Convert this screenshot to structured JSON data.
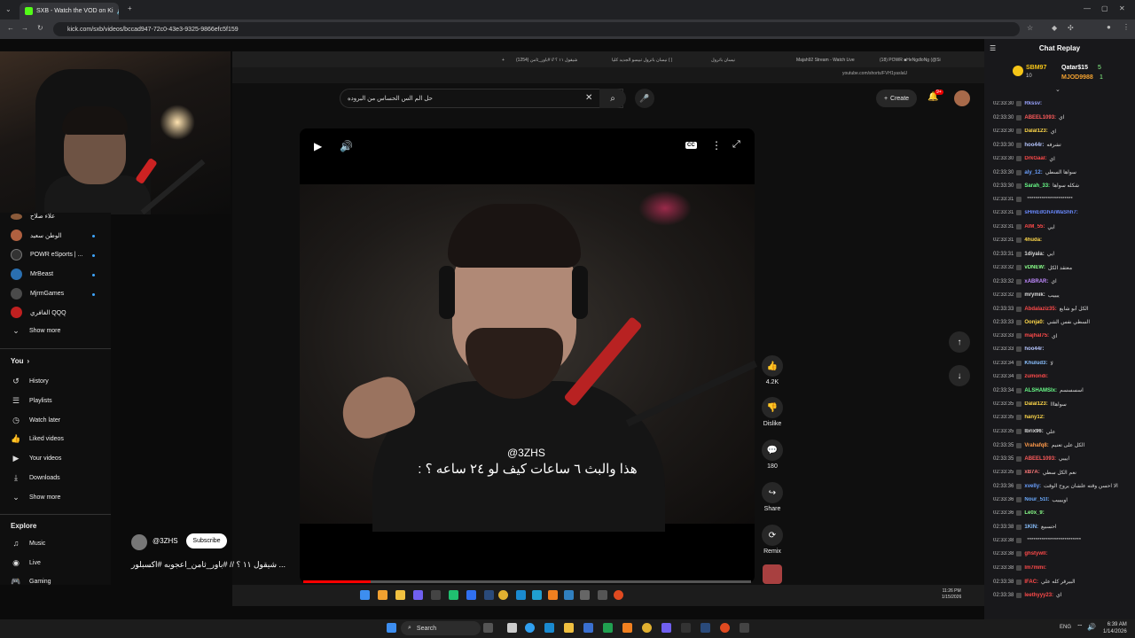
{
  "browser": {
    "active_tab_title": "SXB - Watch the VOD on Ki",
    "url": "kick.com/sxb/videos/bccad947-72c0-43e3-9325-9866efc5f159"
  },
  "inner_browser": {
    "tabs": [
      "شيقول ١١ ؟ // #باور_ثامن (1254)",
      "نيسان باترول تبيسو الجديد كليا ( |",
      "نيسان باترول",
      "Majah92 Stream - Watch Live",
      "(18) POWR ■HeNgdloNg (@Si"
    ],
    "url": "youtube.com/shorts/FVH1yaslaU"
  },
  "youtube": {
    "search_value": "حل الم الس الحساس من البروده",
    "create_label": "Create",
    "notif_count": "9+",
    "sidebar": {
      "subscriptions": [
        {
          "name": "علاء صلاح",
          "color": "#8a5a3a"
        },
        {
          "name": "الوطن سعيد",
          "color": "#b06040"
        },
        {
          "name": "POWR eSports | ...",
          "color": "#333333"
        },
        {
          "name": "MrBeast",
          "color": "#2a6fb0"
        },
        {
          "name": "MjrmGames",
          "color": "#4a4a4a"
        },
        {
          "name": "الغافري QQQ",
          "color": "#c02020"
        }
      ],
      "show_more_1": "Show more",
      "you_heading": "You",
      "you_items": [
        {
          "icon": "history-icon",
          "glyph": "↺",
          "label": "History"
        },
        {
          "icon": "playlists-icon",
          "glyph": "☰",
          "label": "Playlists"
        },
        {
          "icon": "watch-later-icon",
          "glyph": "◷",
          "label": "Watch later"
        },
        {
          "icon": "liked-videos-icon",
          "glyph": "👍",
          "label": "Liked videos"
        },
        {
          "icon": "your-videos-icon",
          "glyph": "▶",
          "label": "Your videos"
        },
        {
          "icon": "downloads-icon",
          "glyph": "⤓",
          "label": "Downloads"
        }
      ],
      "show_more_2": "Show more",
      "explore_heading": "Explore",
      "explore_items": [
        {
          "icon": "music-icon",
          "glyph": "♫",
          "label": "Music"
        },
        {
          "icon": "live-icon",
          "glyph": "◉",
          "label": "Live"
        },
        {
          "icon": "gaming-icon",
          "glyph": "🎮",
          "label": "Gaming"
        }
      ]
    },
    "short": {
      "handle": "@3ZHS",
      "caption": "هذا والبث ٦ ساعات كيف لو ٢٤ ساعه ؟ :",
      "channel": "@3ZHS",
      "subscribe_label": "Subscribe",
      "title": "... شيقول ١١ ؟ // #باور_ثامن_اعجوبه #اكسبلور",
      "progress": 0.15
    },
    "actions": [
      {
        "name": "like",
        "glyph": "👍",
        "label": "4.2K"
      },
      {
        "name": "dislike",
        "glyph": "👎",
        "label": "Dislike"
      },
      {
        "name": "comments",
        "glyph": "💬",
        "label": "180"
      },
      {
        "name": "share",
        "glyph": "↪",
        "label": "Share"
      },
      {
        "name": "remix",
        "glyph": "⟳",
        "label": "Remix"
      }
    ],
    "inner_clock": {
      "time": "11:26 PM",
      "date": "1/15/2026"
    }
  },
  "chat": {
    "title": "Chat Replay",
    "leaderboard": [
      {
        "rank_user": "SBM97",
        "count": "10"
      },
      {
        "rank_user": "Qatar$15",
        "count": "5"
      },
      {
        "rank_user": "MJOD9988",
        "count": "1"
      }
    ],
    "messages": [
      {
        "time": "02:33:30",
        "user": "Rkssv:",
        "color": "#9aa4ff",
        "text": ""
      },
      {
        "time": "02:33:30",
        "user": "ABEEL1093:",
        "color": "#ff5b5b",
        "text": "اي"
      },
      {
        "time": "02:33:30",
        "user": "Dalal123:",
        "color": "#ffd84a",
        "text": "اي"
      },
      {
        "time": "02:33:30",
        "user": "hoo44r:",
        "color": "#b6c6ff",
        "text": "تشرفه"
      },
      {
        "time": "02:33:30",
        "user": "DrkGaal:",
        "color": "#ff4a4a",
        "text": "اي"
      },
      {
        "time": "02:33:30",
        "user": "aly_12:",
        "color": "#6aa0ff",
        "text": "سواها السطي"
      },
      {
        "time": "02:33:30",
        "user": "Sarah_33:",
        "color": "#6aff8a",
        "text": "شكله سواها"
      },
      {
        "time": "02:33:31",
        "user": "",
        "color": "#ddd",
        "text": "**********************"
      },
      {
        "time": "02:33:31",
        "user": "sHmEdGhAiWaShh7:",
        "color": "#6a8aff",
        "text": ""
      },
      {
        "time": "02:33:31",
        "user": "AIM_55:",
        "color": "#ff4a4a",
        "text": "ايي"
      },
      {
        "time": "02:33:31",
        "user": "4huda:",
        "color": "#ffd84a",
        "text": ""
      },
      {
        "time": "02:33:31",
        "user": "1diyala:",
        "color": "#ddd",
        "text": "ايي"
      },
      {
        "time": "02:33:32",
        "user": "vDNEW:",
        "color": "#8aff8a",
        "text": "معتقد الكل"
      },
      {
        "time": "02:33:32",
        "user": "xABRAR:",
        "color": "#c08aff",
        "text": "اي"
      },
      {
        "time": "02:33:32",
        "user": "mrymik:",
        "color": "#ddd",
        "text": "ييييب"
      },
      {
        "time": "02:33:33",
        "user": "Abdalaziz35:",
        "color": "#ff4a4a",
        "text": "الكل أبو شايع"
      },
      {
        "time": "02:33:33",
        "user": "Oonja0:",
        "color": "#ffd84a",
        "text": "السطي نفس الشي"
      },
      {
        "time": "02:33:33",
        "user": "majhal75:",
        "color": "#ff4a4a",
        "text": "اي"
      },
      {
        "time": "02:33:33",
        "user": "hoo44r:",
        "color": "#b6c6ff",
        "text": ""
      },
      {
        "time": "02:33:34",
        "user": "Khulud3:",
        "color": "#8ac0ff",
        "text": "لا"
      },
      {
        "time": "02:33:34",
        "user": "zumondi:",
        "color": "#ff4a4a",
        "text": ""
      },
      {
        "time": "02:33:34",
        "user": "ALSHAMSIx:",
        "color": "#6aff8a",
        "text": "اسسسسم"
      },
      {
        "time": "02:33:35",
        "user": "Dalal123:",
        "color": "#ffd84a",
        "text": "سواهااا"
      },
      {
        "time": "02:33:35",
        "user": "hany12:",
        "color": "#ffd84a",
        "text": ""
      },
      {
        "time": "02:33:35",
        "user": "lbrix96:",
        "color": "#ddd",
        "text": "علي"
      },
      {
        "time": "02:33:35",
        "user": "Vrahafq8:",
        "color": "#ff9a4a",
        "text": "الكل على تعنيم"
      },
      {
        "time": "02:33:35",
        "user": "ABEEL1093:",
        "color": "#ff5b5b",
        "text": "ايييي"
      },
      {
        "time": "02:33:35",
        "user": "xB7A:",
        "color": "#ff7a7a",
        "text": "نعم الكل سطي"
      },
      {
        "time": "02:33:36",
        "user": "xvelly:",
        "color": "#6aa0ff",
        "text": "الا احسن وقته علشان يروح الوقت"
      },
      {
        "time": "02:33:36",
        "user": "Nour_51t:",
        "color": "#6aaaff",
        "text": "اوييييب"
      },
      {
        "time": "02:33:36",
        "user": "Le0x_9:",
        "color": "#8aff8a",
        "text": ""
      },
      {
        "time": "02:33:38",
        "user": "1KIN:",
        "color": "#8ac0ff",
        "text": "احسبيع"
      },
      {
        "time": "02:33:38",
        "user": "",
        "color": "#ddd",
        "text": "**************************"
      },
      {
        "time": "02:33:38",
        "user": "ghstywll:",
        "color": "#ff4a4a",
        "text": ""
      },
      {
        "time": "02:33:38",
        "user": "lm7mmi:",
        "color": "#ff4a4a",
        "text": ""
      },
      {
        "time": "02:33:38",
        "user": "IFAC:",
        "color": "#ff4a4a",
        "text": "البيرقر كله علي"
      },
      {
        "time": "02:33:38",
        "user": "leethyyy23:",
        "color": "#ff4a4a",
        "text": "اي"
      }
    ]
  },
  "taskbar": {
    "search_label": "Search",
    "lang": "ENG",
    "time": "6:39 AM",
    "date": "1/14/2026"
  }
}
